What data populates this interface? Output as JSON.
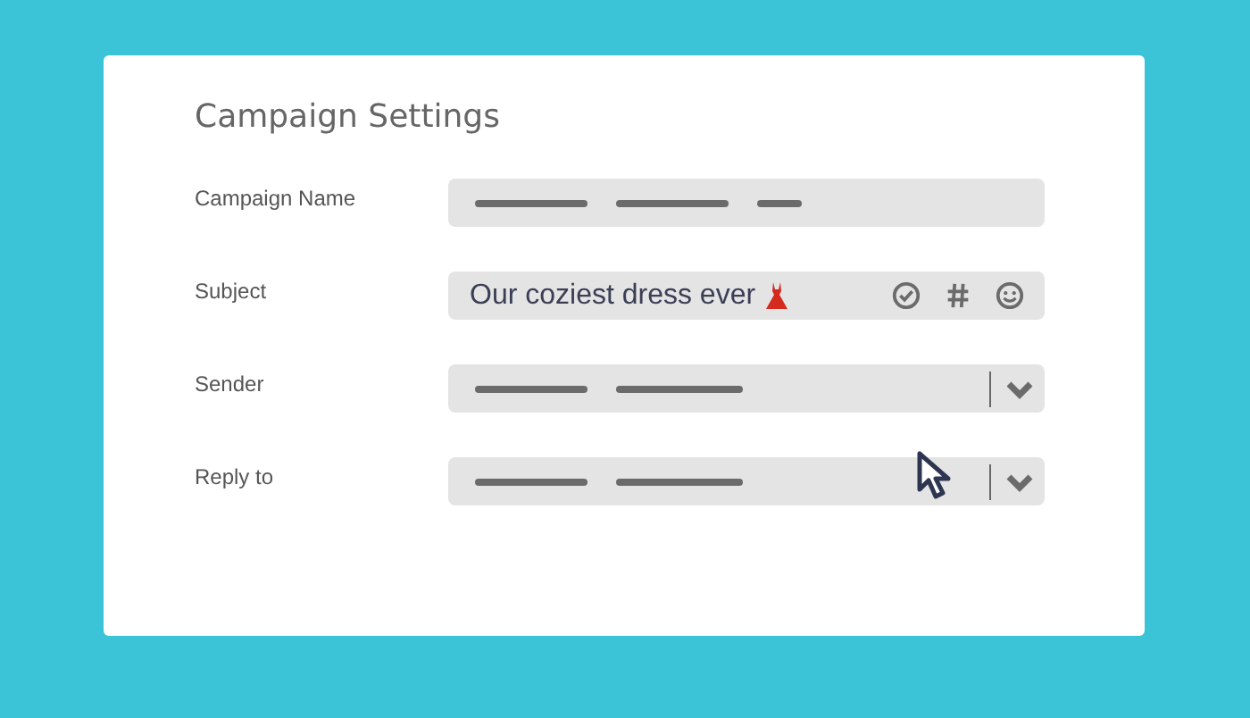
{
  "title": "Campaign Settings",
  "fields": [
    {
      "label": "Campaign Name",
      "kind": "lines"
    },
    {
      "label": "Subject",
      "kind": "text",
      "value": "Our coziest dress ever"
    },
    {
      "label": "Sender",
      "kind": "dropdown"
    },
    {
      "label": "Reply to",
      "kind": "dropdown"
    }
  ]
}
